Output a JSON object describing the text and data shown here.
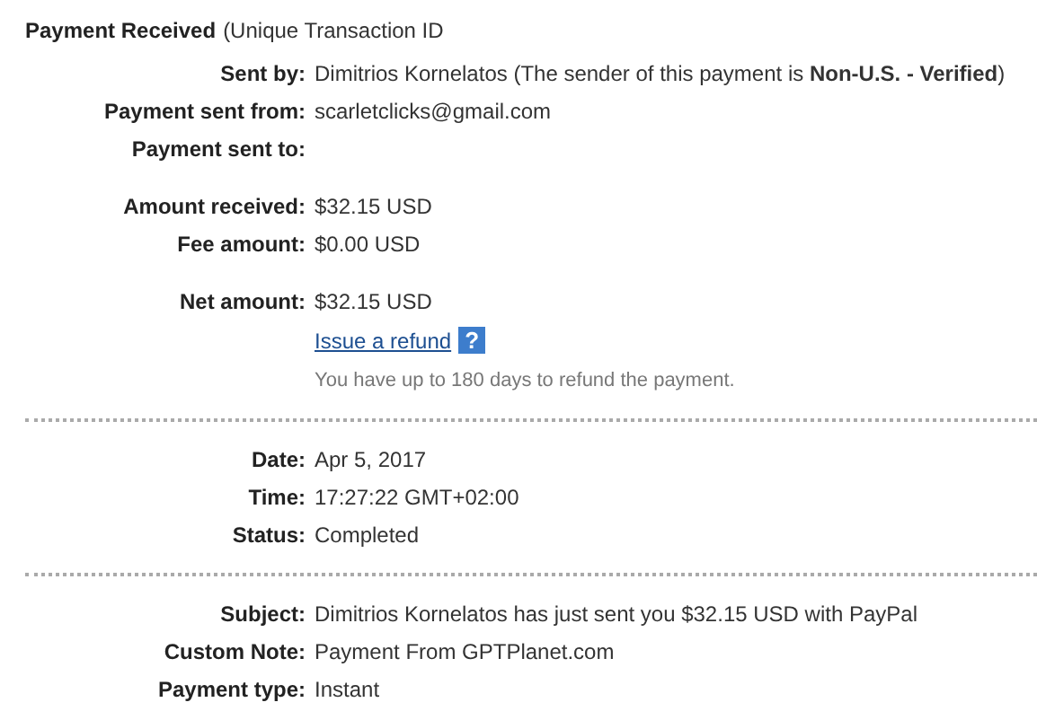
{
  "header": {
    "title": "Payment Received",
    "subtitle": "(Unique Transaction ID"
  },
  "sections": [
    {
      "groups": [
        [
          {
            "kind": "field",
            "label": "Sent by:",
            "value": "Dimitrios Kornelatos (The sender of this payment is **Non-U.S. - Verified**)"
          },
          {
            "kind": "field",
            "label": "Payment sent from:",
            "value": "scarletclicks@gmail.com"
          },
          {
            "kind": "field",
            "label": "Payment sent to:"
          }
        ],
        [
          {
            "kind": "field",
            "label": "Amount received:",
            "value": "$32.15 USD"
          },
          {
            "kind": "field",
            "label": "Fee amount:",
            "value": "$0.00 USD"
          }
        ],
        [
          {
            "kind": "field",
            "label": "Net amount:",
            "value": "$32.15 USD"
          },
          {
            "kind": "link",
            "text": "Issue a refund",
            "help": "?"
          },
          {
            "kind": "note",
            "text": "You have up to 180 days to refund the payment."
          }
        ]
      ]
    },
    {
      "groups": [
        [
          {
            "kind": "field",
            "label": "Date:",
            "value": "Apr 5, 2017"
          },
          {
            "kind": "field",
            "label": "Time:",
            "value": "17:27:22 GMT+02:00"
          },
          {
            "kind": "field",
            "label": "Status:",
            "value": "Completed"
          }
        ]
      ]
    },
    {
      "groups": [
        [
          {
            "kind": "field",
            "label": "Subject:",
            "value": "Dimitrios Kornelatos has just sent you $32.15 USD with PayPal"
          },
          {
            "kind": "field",
            "label": "Custom Note:",
            "value": "Payment From GPTPlanet.com"
          },
          {
            "kind": "field",
            "label": "Payment type:",
            "value": "Instant"
          }
        ]
      ]
    }
  ]
}
